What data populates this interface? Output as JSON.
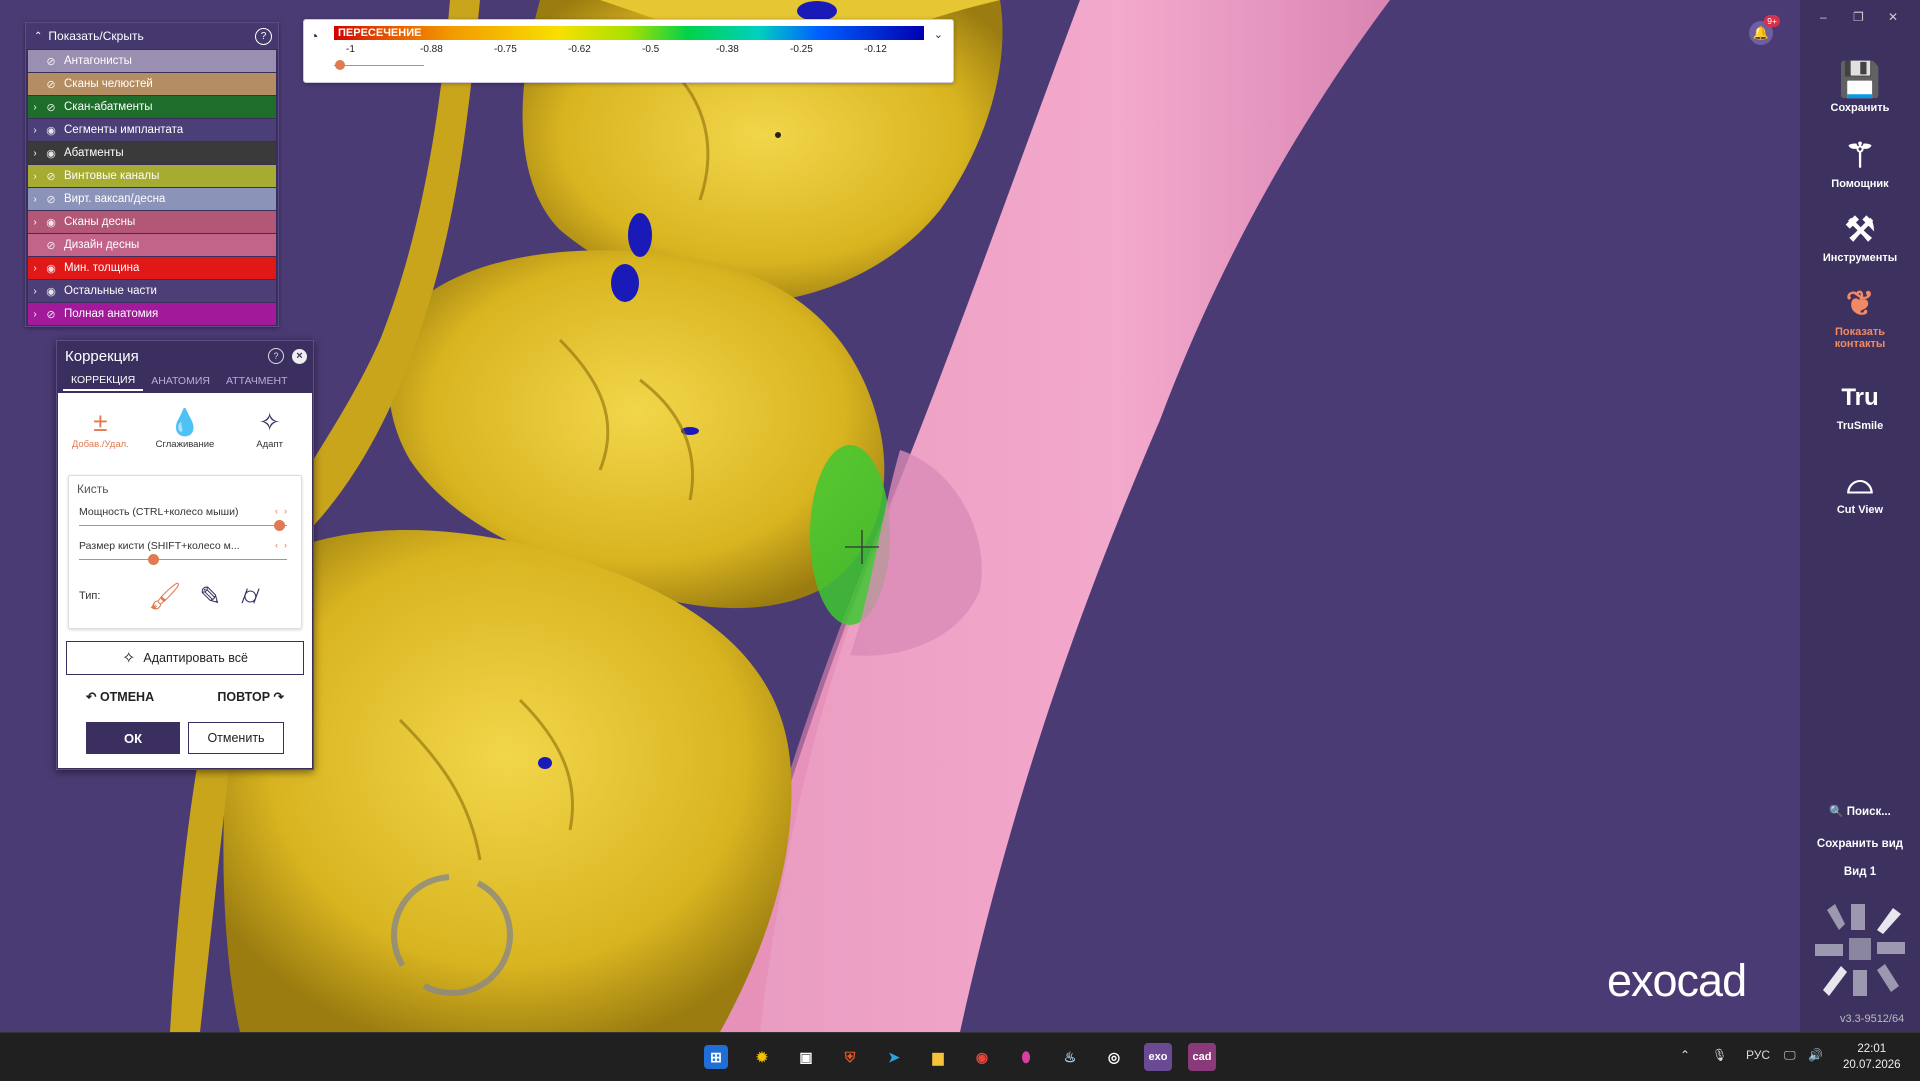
{
  "showhide": {
    "title": "Показать/Скрыть",
    "items": [
      {
        "label": "Антагонисты",
        "color": "#9a8fb0",
        "expandable": false,
        "eye": "hidden"
      },
      {
        "label": "Сканы челюстей",
        "color": "#b58d62",
        "expandable": false,
        "eye": "hidden"
      },
      {
        "label": "Скан-абатменты",
        "color": "#1e6d2a",
        "expandable": true,
        "eye": "hidden"
      },
      {
        "label": "Сегменты имплантата",
        "color": "#4c3e76",
        "expandable": true,
        "eye": "visible"
      },
      {
        "label": "Абатменты",
        "color": "#3a3a3a",
        "expandable": true,
        "eye": "visible"
      },
      {
        "label": "Винтовые каналы",
        "color": "#a6ab32",
        "expandable": true,
        "eye": "hidden"
      },
      {
        "label": "Вирт. ваксап/десна",
        "color": "#8c93b8",
        "expandable": true,
        "eye": "hidden"
      },
      {
        "label": "Сканы десны",
        "color": "#b25876",
        "expandable": true,
        "eye": "visible"
      },
      {
        "label": "Дизайн десны",
        "color": "#c2648a",
        "expandable": false,
        "eye": "hidden"
      },
      {
        "label": "Мин. толщина",
        "color": "#e01818",
        "expandable": true,
        "eye": "visible"
      },
      {
        "label": "Остальные части",
        "color": "#4c3e76",
        "expandable": true,
        "eye": "visible"
      },
      {
        "label": "Полная анатомия",
        "color": "#a01a9a",
        "expandable": true,
        "eye": "hidden"
      }
    ]
  },
  "correction": {
    "title": "Коррекция",
    "tabs": [
      "КОРРЕКЦИЯ",
      "АНАТОМИЯ",
      "АТТАЧМЕНТ"
    ],
    "tools": [
      {
        "label": "Добав./Удал.",
        "icon": "plus-minus-icon",
        "active": true
      },
      {
        "label": "Сглаживание",
        "icon": "drop-icon",
        "active": false
      },
      {
        "label": "Адапт",
        "icon": "adapt-wand-icon",
        "active": false
      }
    ],
    "brush_title": "Кисть",
    "strength_label": "Мощность (CTRL+колесо мыши)",
    "strength_value": 0.95,
    "size_label": "Размер кисти (SHIFT+колесо м...",
    "size_value": 0.35,
    "type_label": "Тип:",
    "adapt_all": "Адаптировать всё",
    "undo": "ОТМЕНА",
    "redo": "ПОВТОР",
    "ok": "ОК",
    "cancel": "Отменить"
  },
  "legend": {
    "title": "ПЕРЕСЕЧЕНИЕ",
    "ticks": [
      "-1",
      "-0.88",
      "-0.75",
      "-0.62",
      "-0.5",
      "-0.38",
      "-0.25",
      "-0.12"
    ],
    "slider_value": 0.0
  },
  "notification": {
    "badge": "9+"
  },
  "window": {
    "minimize": "–",
    "restore": "❐",
    "close": "✕"
  },
  "toolbar": [
    {
      "label": "Сохранить",
      "icon": "save-icon"
    },
    {
      "label": "Помощник",
      "icon": "wizard-wand-icon"
    },
    {
      "label": "Инструменты",
      "icon": "tools-icon"
    },
    {
      "label": "Показать контакты",
      "icon": "contacts-icon",
      "accent": "#f08a64"
    },
    {
      "label": "TruSmile",
      "icon": "trusmile-icon"
    },
    {
      "label": "Cut View",
      "icon": "cut-view-icon"
    }
  ],
  "search_label": "Поиск...",
  "save_view": "Сохранить вид",
  "view_name": "Вид 1",
  "brand": "exocad",
  "version": "v3.3-9512/64",
  "tray": {
    "lang": "РУС",
    "time": "22:01",
    "date": "20.07.2026"
  }
}
